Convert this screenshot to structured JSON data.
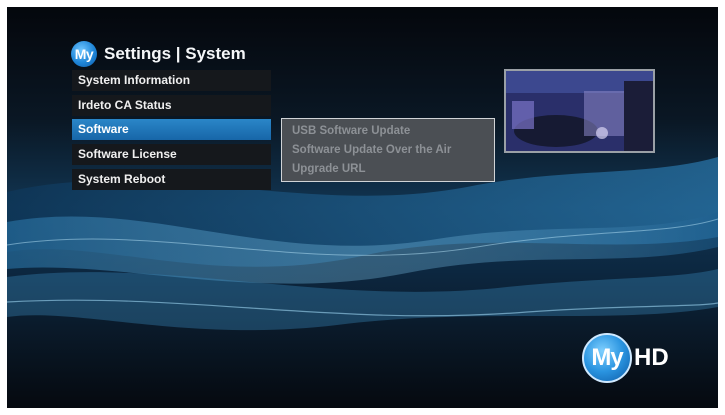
{
  "header": {
    "logo_text": "My",
    "title": "Settings | System"
  },
  "menu": {
    "items": [
      {
        "label": "System Information"
      },
      {
        "label": "Irdeto CA Status"
      },
      {
        "label": "Software"
      },
      {
        "label": "Software License"
      },
      {
        "label": "System Reboot"
      }
    ],
    "selected_index": 2
  },
  "submenu": {
    "items": [
      {
        "label": "USB Software Update"
      },
      {
        "label": "Software Update Over the Air"
      },
      {
        "label": "Upgrade URL"
      }
    ]
  },
  "brand": {
    "logo_circle": "My",
    "logo_suffix": "HD"
  },
  "colors": {
    "accent": "#1f78be",
    "menu_bg": "#15181c",
    "submenu_bg": "#4b4f54"
  }
}
